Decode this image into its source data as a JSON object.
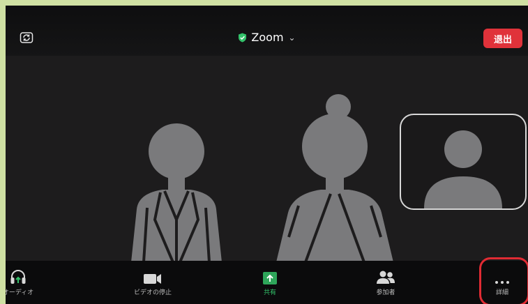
{
  "header": {
    "title": "Zoom",
    "leave_label": "退出"
  },
  "toolbar": {
    "audio_label": "オーディオ",
    "video_label": "ビデオの停止",
    "share_label": "共有",
    "participants_label": "参加者",
    "more_label": "詳細"
  },
  "colors": {
    "leave": "#e0323a",
    "share_green": "#2ea65a",
    "audio_green": "#33c26a",
    "highlight": "#e02b33",
    "placeholder_gray": "#7a7a7c"
  },
  "icons": [
    "rotate-camera-icon",
    "shield-check-icon",
    "chevron-down-icon",
    "headphones-icon",
    "video-camera-icon",
    "share-arrow-icon",
    "participants-icon",
    "more-dots-icon",
    "person-avatar-icon"
  ]
}
